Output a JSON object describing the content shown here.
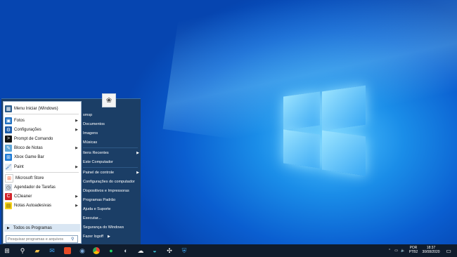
{
  "start_menu": {
    "pinned": [
      {
        "label": "Menu Iniciar (Windows)",
        "icon": "windows-start-icon",
        "arrow": false
      },
      {
        "label": "Fotos",
        "icon": "photos-icon",
        "arrow": true
      },
      {
        "label": "Configurações",
        "icon": "settings-icon",
        "arrow": true
      },
      {
        "label": "Prompt de Comando",
        "icon": "command-prompt-icon",
        "arrow": false
      },
      {
        "label": "Bloco de Notas",
        "icon": "notepad-icon",
        "arrow": true
      },
      {
        "label": "Xbox Game Bar",
        "icon": "xbox-icon",
        "arrow": false
      },
      {
        "label": "Paint",
        "icon": "paint-icon",
        "arrow": true
      },
      {
        "label": "Microsoft Store",
        "icon": "store-icon",
        "arrow": false
      },
      {
        "label": "Agendador de Tarefas",
        "icon": "task-scheduler-icon",
        "arrow": false
      },
      {
        "label": "CCleaner",
        "icon": "ccleaner-icon",
        "arrow": true
      },
      {
        "label": "Notas Autoadesivas",
        "icon": "sticky-notes-icon",
        "arrow": true
      }
    ],
    "all_programs": "Todos os Programas",
    "search_placeholder": "Pesquisar programas e arquivos",
    "right_items": [
      {
        "label": "smsp",
        "arrow": false
      },
      {
        "label": "Documentos",
        "arrow": false
      },
      {
        "label": "Imagens",
        "arrow": false
      },
      {
        "label": "Músicas",
        "arrow": false
      },
      {
        "label": "Itens Recentes",
        "arrow": true
      },
      {
        "label": "Este Computador",
        "arrow": false
      },
      {
        "label": "Painel de controle",
        "arrow": true
      },
      {
        "label": "Configurações do computador",
        "arrow": false
      },
      {
        "label": "Dispositivos e Impressoras",
        "arrow": false
      },
      {
        "label": "Programas Padrão",
        "arrow": false
      },
      {
        "label": "Ajuda e Suporte",
        "arrow": false
      },
      {
        "label": "Executar...",
        "arrow": false
      },
      {
        "label": "Segurança do Windows",
        "arrow": false
      }
    ],
    "logoff": "Fazer logoff"
  },
  "taskbar": {
    "apps": [
      "start-icon",
      "search-icon",
      "file-explorer-icon",
      "mail-icon",
      "office-icon",
      "steam-icon",
      "chrome-icon",
      "spotify-icon",
      "media-icon",
      "cloud-icon",
      "edge-icon",
      "network-icon",
      "windows-security-icon"
    ],
    "language": [
      "POR",
      "PTB2"
    ],
    "time": "18:37",
    "date": "30/08/2020"
  }
}
